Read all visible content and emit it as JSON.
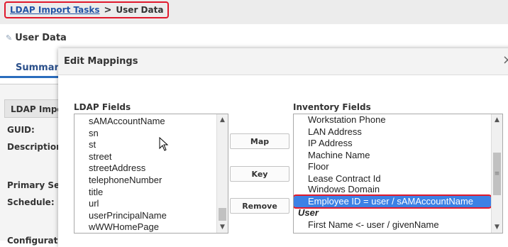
{
  "breadcrumb": {
    "link": "LDAP Import Tasks",
    "separator": ">",
    "current": "User Data"
  },
  "page": {
    "title": "User Data",
    "title_icon": "pencil-icon"
  },
  "background": {
    "tab": "Summary",
    "section_header": "LDAP Impo",
    "rows": [
      "GUID:",
      "Description",
      "Primary Se",
      "Schedule:",
      "Configurat"
    ]
  },
  "modal": {
    "title": "Edit Mappings",
    "close": "×",
    "ldap_label": "LDAP Fields",
    "inventory_label": "Inventory Fields",
    "buttons": {
      "map": "Map",
      "key": "Key",
      "remove": "Remove"
    },
    "ldap_fields": [
      "sAMAccountName",
      "sn",
      "st",
      "street",
      "streetAddress",
      "telephoneNumber",
      "title",
      "url",
      "userPrincipalName",
      "wWWHomePage"
    ],
    "inventory_fields": [
      "Workstation Phone",
      "LAN Address",
      "IP Address",
      "Machine Name",
      "Floor",
      "Lease Contract Id",
      "Windows Domain",
      "Employee ID = user / sAMAccountName",
      "User",
      "First Name <- user / givenName"
    ],
    "selected_inventory": "Employee ID = user / sAMAccountName"
  },
  "colors": {
    "highlight_red": "#e0192c",
    "selection_blue": "#3c81e5",
    "link_blue": "#2354a6"
  }
}
